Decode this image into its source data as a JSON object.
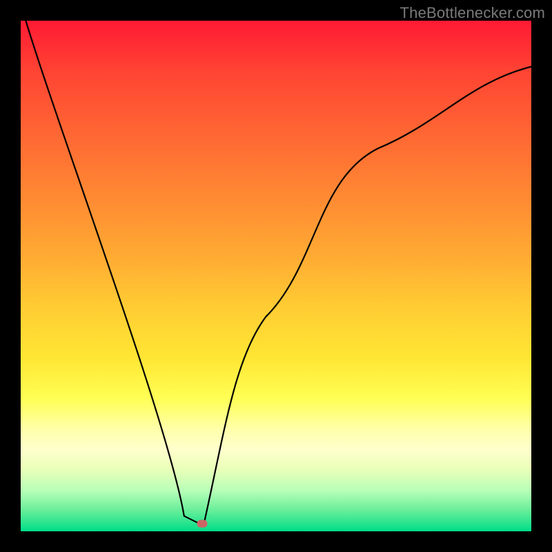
{
  "watermark": "TheBottlenecker.com",
  "chart_data": {
    "type": "line",
    "title": "",
    "xlabel": "",
    "ylabel": "",
    "xlim": [
      0,
      100
    ],
    "ylim": [
      0,
      100
    ],
    "gradient_stops": [
      {
        "pos": 0,
        "color": "#ff1a33"
      },
      {
        "pos": 50,
        "color": "#ffcc33"
      },
      {
        "pos": 80,
        "color": "#ffffaa"
      },
      {
        "pos": 100,
        "color": "#00dd88"
      }
    ],
    "curve": {
      "left_branch": [
        {
          "x": 1,
          "y": 100
        },
        {
          "x": 32,
          "y": 3
        },
        {
          "x": 34,
          "y": 2
        }
      ],
      "right_branch": [
        {
          "x": 36,
          "y": 2
        },
        {
          "x": 48,
          "y": 42
        },
        {
          "x": 70,
          "y": 75
        },
        {
          "x": 100,
          "y": 91
        }
      ],
      "min_point": {
        "x": 35,
        "y": 1.5
      }
    },
    "marker": {
      "x": 35.5,
      "y": 1.5,
      "color": "#cc6666"
    }
  }
}
